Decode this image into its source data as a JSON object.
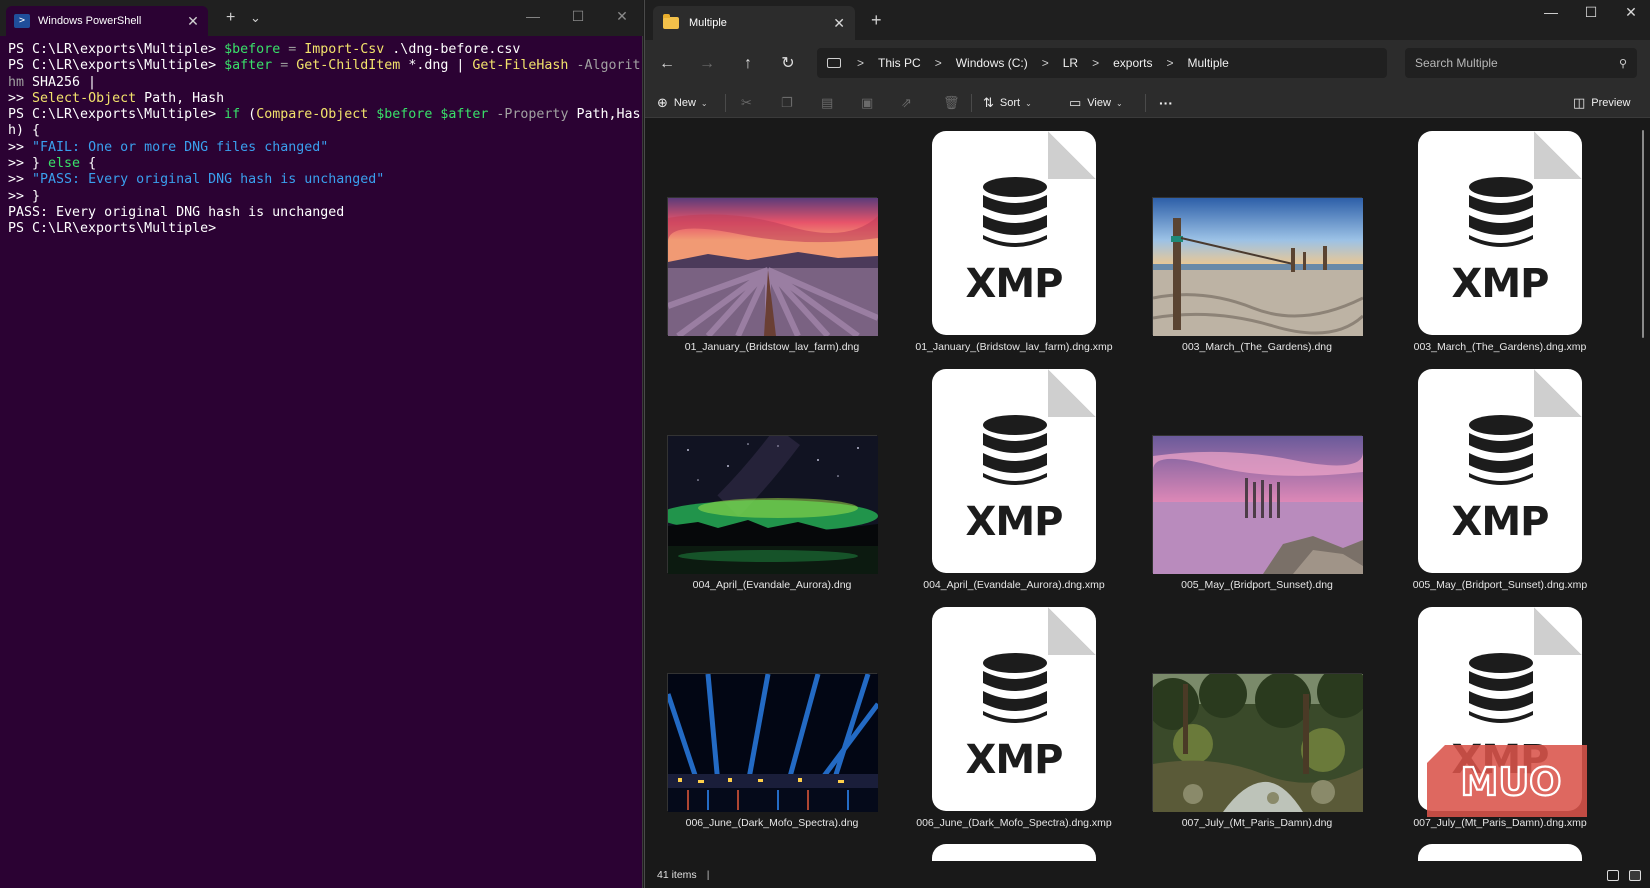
{
  "powershell": {
    "tab_title": "Windows PowerShell",
    "close_glyph": "✕",
    "new_tab_glyph": "+",
    "dropdown_glyph": "⌄",
    "min_glyph": "—",
    "max_glyph": "☐",
    "winclose_glyph": "✕",
    "lines": [
      [
        {
          "t": "PS C:\\LR\\exports\\Multiple> ",
          "c": "c-prompt"
        },
        {
          "t": "$before",
          "c": "c-var"
        },
        {
          "t": " = ",
          "c": "c-op"
        },
        {
          "t": "Import-Csv",
          "c": "c-cmd"
        },
        {
          "t": " .\\dng-before.csv",
          "c": "c-txt"
        }
      ],
      [
        {
          "t": "PS C:\\LR\\exports\\Multiple> ",
          "c": "c-prompt"
        },
        {
          "t": "$after",
          "c": "c-var"
        },
        {
          "t": " = ",
          "c": "c-op"
        },
        {
          "t": "Get-ChildItem",
          "c": "c-cmd"
        },
        {
          "t": " *.dng | ",
          "c": "c-txt"
        },
        {
          "t": "Get-FileHash",
          "c": "c-cmd"
        },
        {
          "t": " -Algorit",
          "c": "c-param"
        }
      ],
      [
        {
          "t": "hm",
          "c": "c-param"
        },
        {
          "t": " SHA256 |",
          "c": "c-txt"
        }
      ],
      [
        {
          "t": ">> ",
          "c": "c-prompt"
        },
        {
          "t": "Select-Object",
          "c": "c-cmd"
        },
        {
          "t": " Path, Hash",
          "c": "c-txt"
        }
      ],
      [
        {
          "t": "PS C:\\LR\\exports\\Multiple> ",
          "c": "c-prompt"
        },
        {
          "t": "if",
          "c": "c-kw"
        },
        {
          "t": " (",
          "c": "c-txt"
        },
        {
          "t": "Compare-Object",
          "c": "c-cmd"
        },
        {
          "t": " ",
          "c": "c-txt"
        },
        {
          "t": "$before",
          "c": "c-var"
        },
        {
          "t": " ",
          "c": "c-txt"
        },
        {
          "t": "$after",
          "c": "c-var"
        },
        {
          "t": " -Property",
          "c": "c-param"
        },
        {
          "t": " Path,Has",
          "c": "c-txt"
        }
      ],
      [
        {
          "t": "h) {",
          "c": "c-txt"
        }
      ],
      [
        {
          "t": ">> ",
          "c": "c-prompt"
        },
        {
          "t": "\"FAIL: One or more DNG files changed\"",
          "c": "c-str"
        }
      ],
      [
        {
          "t": ">> } ",
          "c": "c-prompt"
        },
        {
          "t": "else",
          "c": "c-kw"
        },
        {
          "t": " {",
          "c": "c-txt"
        }
      ],
      [
        {
          "t": ">> ",
          "c": "c-prompt"
        },
        {
          "t": "\"PASS: Every original DNG hash is unchanged\"",
          "c": "c-str"
        }
      ],
      [
        {
          "t": ">> }",
          "c": "c-prompt"
        }
      ],
      [
        {
          "t": "PASS: Every original DNG hash is unchanged",
          "c": "c-txt"
        }
      ],
      [
        {
          "t": "PS C:\\LR\\exports\\Multiple>",
          "c": "c-prompt"
        }
      ]
    ]
  },
  "explorer": {
    "tab_title": "Multiple",
    "close_glyph": "✕",
    "new_tab_glyph": "+",
    "min_glyph": "—",
    "max_glyph": "☐",
    "winclose_glyph": "✕",
    "nav": {
      "back": "←",
      "forward": "→",
      "up": "↑",
      "refresh": "↻"
    },
    "breadcrumb": [
      "This PC",
      "Windows (C:)",
      "LR",
      "exports",
      "Multiple"
    ],
    "breadcrumb_sep": ">",
    "search_placeholder": "Search Multiple",
    "search_glyph": "⚲",
    "toolbar": {
      "new_label": "New",
      "sort_label": "Sort",
      "view_label": "View",
      "more_glyph": "···",
      "preview_label": "Preview",
      "caret_glyph": "⌄"
    },
    "files": [
      {
        "name": "01_January_(Bridstow_lav_farm).dng",
        "kind": "photo",
        "scene": "lavender"
      },
      {
        "name": "01_January_(Bridstow_lav_farm).dng.xmp",
        "kind": "xmp"
      },
      {
        "name": "003_March_(The_Gardens).dng",
        "kind": "photo",
        "scene": "beach"
      },
      {
        "name": "003_March_(The_Gardens).dng.xmp",
        "kind": "xmp"
      },
      {
        "name": "004_April_(Evandale_Aurora).dng",
        "kind": "photo",
        "scene": "aurora"
      },
      {
        "name": "004_April_(Evandale_Aurora).dng.xmp",
        "kind": "xmp"
      },
      {
        "name": "005_May_(Bridport_Sunset).dng",
        "kind": "photo",
        "scene": "sunset"
      },
      {
        "name": "005_May_(Bridport_Sunset).dng.xmp",
        "kind": "xmp"
      },
      {
        "name": "006_June_(Dark_Mofo_Spectra).dng",
        "kind": "photo",
        "scene": "spectra"
      },
      {
        "name": "006_June_(Dark_Mofo_Spectra).dng.xmp",
        "kind": "xmp"
      },
      {
        "name": "007_July_(Mt_Paris_Damn).dng",
        "kind": "photo",
        "scene": "forest"
      },
      {
        "name": "007_July_(Mt_Paris_Damn).dng.xmp",
        "kind": "xmp"
      }
    ],
    "xmp_label": "XMP",
    "status_count": "41 items",
    "status_sep": "|",
    "watermark_text": "MUO"
  }
}
